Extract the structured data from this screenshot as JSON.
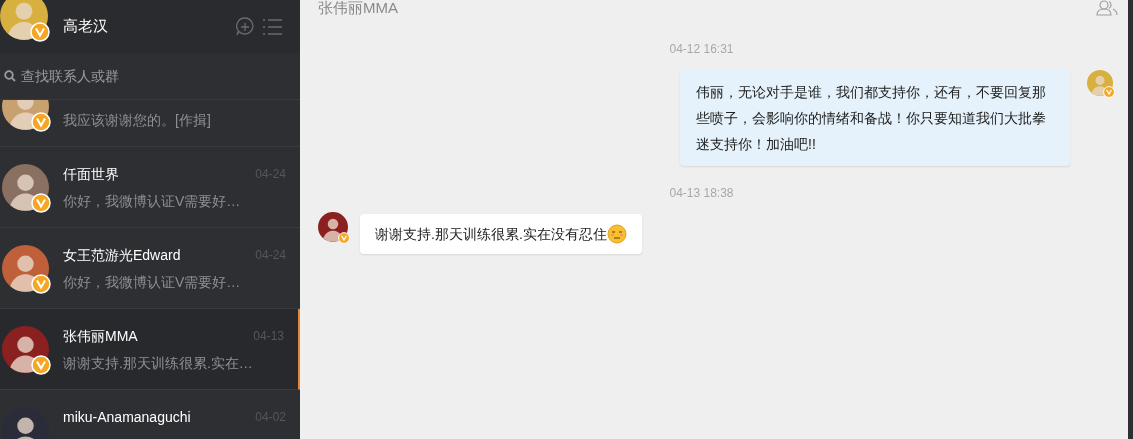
{
  "sidebar": {
    "user": {
      "name": "高老汉",
      "verified": true
    },
    "search": {
      "placeholder": "查找联系人或群"
    },
    "conversations": [
      {
        "preview": "我应该谢谢您的。[作揖]",
        "verified": true,
        "selected": false
      },
      {
        "name": "仟面世界",
        "time": "04-24",
        "preview": "你好，我微博认证V需要好…",
        "verified": true,
        "selected": false
      },
      {
        "name": "女王范游光Edward",
        "time": "04-24",
        "preview": "你好，我微博认证V需要好…",
        "verified": true,
        "selected": false
      },
      {
        "name": "张伟丽MMA",
        "time": "04-13",
        "preview": "谢谢支持.那天训练很累.实在…",
        "verified": true,
        "selected": true
      },
      {
        "name": "miku-Anamanaguchi",
        "time": "04-02",
        "verified": false,
        "selected": false
      }
    ]
  },
  "chat": {
    "title": "张伟丽MMA",
    "messages": [
      {
        "kind": "time",
        "text": "04-12 16:31"
      },
      {
        "kind": "outgoing",
        "text": "伟丽，无论对手是谁，我们都支持你，还有，不要回复那些喷子，会影响你的情绪和备战！你只要知道我们大批拳迷支持你！加油吧!!",
        "emoji": false
      },
      {
        "kind": "time",
        "text": "04-13 18:38"
      },
      {
        "kind": "incoming",
        "text": "谢谢支持.那天训练很累.实在没有忍住",
        "emoji": true
      }
    ]
  }
}
